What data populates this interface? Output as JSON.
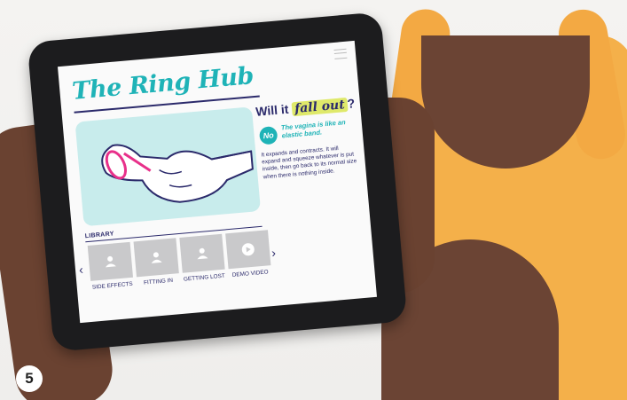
{
  "app": {
    "title": "The Ring Hub"
  },
  "question": {
    "prefix": "Will it ",
    "highlight": "fall out",
    "suffix": "?"
  },
  "answer": {
    "badge": "No",
    "tagline": "The vagina is like an elastic band.",
    "body": "It expands and contracts. It will expand and squeeze whatever is put inside, then go back to its normal size when there is nothing inside."
  },
  "library": {
    "label": "LIBRARY",
    "items": [
      {
        "label": "SIDE EFFECTS",
        "icon": "person-icon"
      },
      {
        "label": "FITTING IN",
        "icon": "person-icon"
      },
      {
        "label": "GETTING LOST",
        "icon": "person-icon"
      },
      {
        "label": "DEMO VIDEO",
        "icon": "play-icon"
      }
    ]
  },
  "step_number": "5",
  "colors": {
    "accent": "#1fb3b7",
    "navy": "#2b2a6b",
    "highlight": "#dfe96a",
    "illustration_bg": "#c8ecec",
    "ring": "#e8308a"
  }
}
